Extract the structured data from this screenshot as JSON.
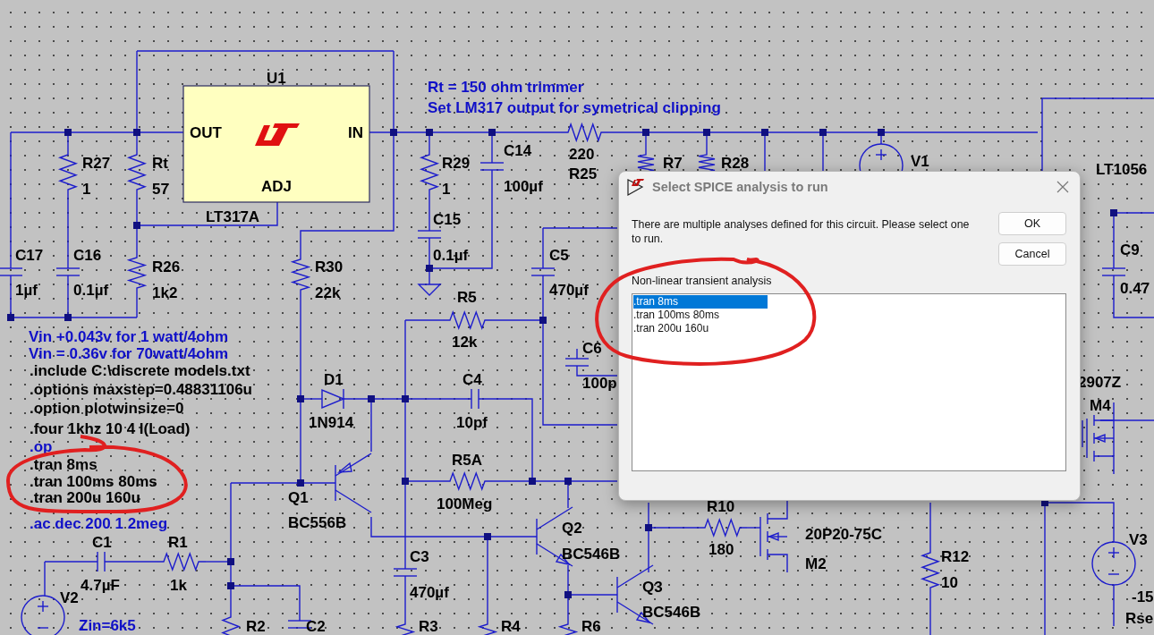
{
  "schematic": {
    "parts": [
      {
        "kind": "regulator",
        "ref": "U1",
        "value": "LT317A",
        "pins": [
          "OUT",
          "IN",
          "ADJ"
        ]
      },
      {
        "kind": "resistor",
        "ref": "R27",
        "value": "1"
      },
      {
        "kind": "resistor",
        "ref": "Rt",
        "value": "57"
      },
      {
        "kind": "capacitor",
        "ref": "C17",
        "value": "1µf"
      },
      {
        "kind": "capacitor",
        "ref": "C16",
        "value": "0.1µf"
      },
      {
        "kind": "resistor",
        "ref": "R26",
        "value": "1k2"
      },
      {
        "kind": "resistor",
        "ref": "R30",
        "value": "22k"
      },
      {
        "kind": "resistor",
        "ref": "R29",
        "value": "1"
      },
      {
        "kind": "capacitor",
        "ref": "C14",
        "value": "100µf"
      },
      {
        "kind": "capacitor",
        "ref": "C15",
        "value": "0.1µf"
      },
      {
        "kind": "resistor",
        "ref": "R25",
        "value": "220"
      },
      {
        "kind": "resistor",
        "ref": "R7"
      },
      {
        "kind": "resistor",
        "ref": "R28"
      },
      {
        "kind": "source",
        "ref": "V1"
      },
      {
        "kind": "label",
        "value": "LT1056"
      },
      {
        "kind": "capacitor",
        "ref": "C5",
        "value": "470µf"
      },
      {
        "kind": "capacitor",
        "ref": "C9",
        "value": "0.47"
      },
      {
        "kind": "resistor",
        "ref": "R5",
        "value": "12k"
      },
      {
        "kind": "capacitor",
        "ref": "C6",
        "value": "100p"
      },
      {
        "kind": "diode",
        "ref": "D1",
        "value": "1N914"
      },
      {
        "kind": "capacitor",
        "ref": "C4",
        "value": "10pf"
      },
      {
        "kind": "resistor",
        "ref": "R5A",
        "value": "100Meg"
      },
      {
        "kind": "pnp",
        "ref": "Q1",
        "value": "BC556B"
      },
      {
        "kind": "npn",
        "ref": "Q2",
        "value": "BC546B"
      },
      {
        "kind": "npn",
        "ref": "Q3",
        "value": "BC546B"
      },
      {
        "kind": "capacitor",
        "ref": "C3",
        "value": "470µf"
      },
      {
        "kind": "resistor",
        "ref": "R10",
        "value": "180"
      },
      {
        "kind": "mosfet",
        "ref": "M2",
        "value": "20P20-75C"
      },
      {
        "kind": "resistor",
        "ref": "R12",
        "value": "10"
      },
      {
        "kind": "source",
        "ref": "V3",
        "value": "-15"
      },
      {
        "kind": "label",
        "ref": "Rse"
      },
      {
        "kind": "mosfet",
        "ref": "M4",
        "value": "2907Z"
      },
      {
        "kind": "capacitor",
        "ref": "C1",
        "value": "4.7µF"
      },
      {
        "kind": "resistor",
        "ref": "R1",
        "value": "1k"
      },
      {
        "kind": "source",
        "ref": "V2"
      },
      {
        "kind": "resistor",
        "ref": "R2"
      },
      {
        "kind": "capacitor",
        "ref": "C2"
      },
      {
        "kind": "resistor",
        "ref": "R3"
      },
      {
        "kind": "resistor",
        "ref": "R4"
      },
      {
        "kind": "resistor",
        "ref": "R6"
      }
    ],
    "comments": [
      "Rt = 150 ohm trimmer",
      "Set LM317 output for symetrical clipping",
      "Vin +0.043v for 1 watt/4ohm",
      "Vin = 0.36v for 70watt/4ohm",
      "Zin=6k5"
    ],
    "directives": [
      {
        "text": ".include C:\\discrete models.txt",
        "active": true
      },
      {
        "text": ".options maxstep=0.48831106u",
        "active": true
      },
      {
        "text": ".option plotwinsize=0",
        "active": true
      },
      {
        "text": ".four 1khz 10 4 I(Load)",
        "active": true
      },
      {
        "text": ".op",
        "active": false
      },
      {
        "text": ".tran 8ms",
        "active": true
      },
      {
        "text": ".tran 100ms 80ms",
        "active": true
      },
      {
        "text": ".tran 200u 160u",
        "active": true
      },
      {
        "text": ".ac dec 200 1 2meg",
        "active": false
      }
    ]
  },
  "dialog": {
    "title": "Select SPICE analysis to run",
    "message": "There are multiple analyses defined for this circuit.  Please select one to run.",
    "buttons": [
      "OK",
      "Cancel"
    ],
    "group_label": "Non-linear transient analysis",
    "options": [
      {
        "label": ".tran 8ms",
        "selected": true
      },
      {
        "label": ".tran 100ms 80ms",
        "selected": false
      },
      {
        "label": ".tran 200u 160u",
        "selected": false
      }
    ]
  }
}
